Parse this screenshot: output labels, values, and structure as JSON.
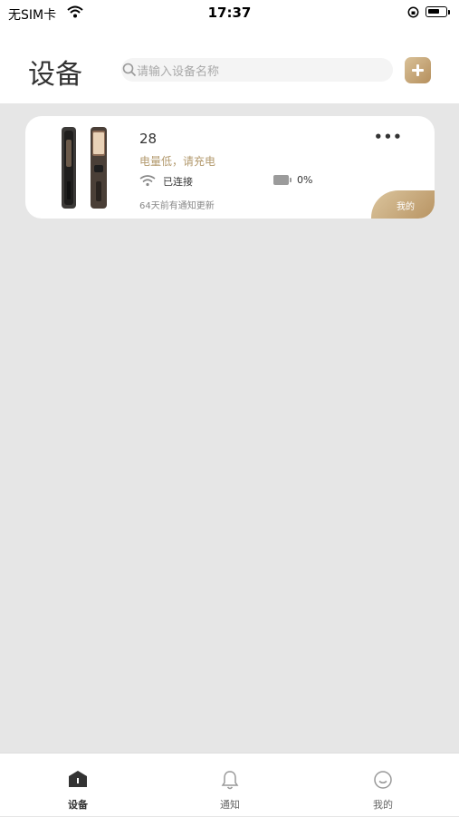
{
  "statusbar": {
    "carrier": "无SIM卡",
    "time": "17:37"
  },
  "header": {
    "title": "设备",
    "search_placeholder": "请输入设备名称"
  },
  "device": {
    "name": "28",
    "warning": "电量低，请充电",
    "connection_status": "已连接",
    "battery_percent": "0%",
    "update_text": "64天前有通知更新",
    "owner_badge": "我的",
    "more_label": "•••"
  },
  "tabs": [
    {
      "label": "设备",
      "icon": "home-icon",
      "active": true
    },
    {
      "label": "通知",
      "icon": "bell-icon",
      "active": false
    },
    {
      "label": "我的",
      "icon": "smile-icon",
      "active": false
    }
  ],
  "colors": {
    "accent": "#b58f5d",
    "warning_text": "#b39a6e",
    "background": "#e6e6e6"
  }
}
